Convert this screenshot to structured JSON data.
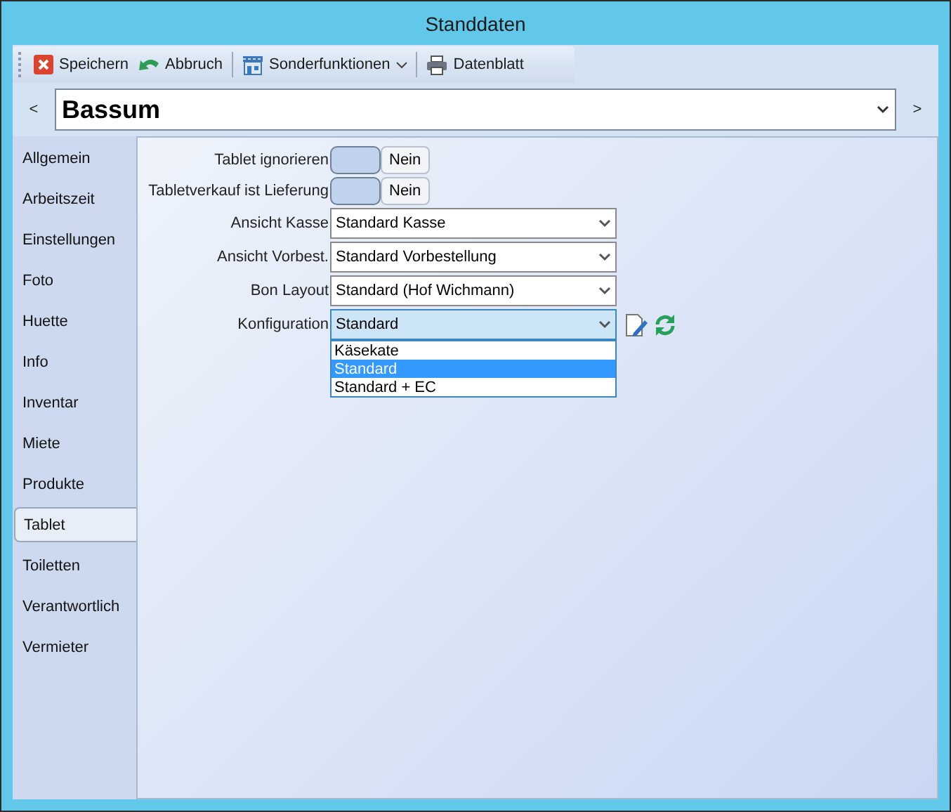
{
  "window": {
    "title": "Standdaten"
  },
  "toolbar": [
    {
      "kind": "save",
      "label": "Speichern"
    },
    {
      "kind": "cancel",
      "label": "Abbruch"
    },
    {
      "kind": "special",
      "label": "Sonderfunktionen",
      "dropdown": true
    },
    {
      "kind": "print",
      "label": "Datenblatt"
    }
  ],
  "record": {
    "prev": "<",
    "value": "Bassum",
    "next": ">"
  },
  "tabs": [
    {
      "label": "Allgemein",
      "selected": false
    },
    {
      "label": "Arbeitszeit",
      "selected": false
    },
    {
      "label": "Einstellungen",
      "selected": false
    },
    {
      "label": "Foto",
      "selected": false
    },
    {
      "label": "Huette",
      "selected": false
    },
    {
      "label": "Info",
      "selected": false
    },
    {
      "label": "Inventar",
      "selected": false
    },
    {
      "label": "Miete",
      "selected": false
    },
    {
      "label": "Produkte",
      "selected": false
    },
    {
      "label": "Tablet",
      "selected": true
    },
    {
      "label": "Toiletten",
      "selected": false
    },
    {
      "label": "Verantwortlich",
      "selected": false
    },
    {
      "label": "Vermieter",
      "selected": false
    }
  ],
  "fields": [
    {
      "kind": "toggle",
      "label": "Tablet ignorieren",
      "on": false,
      "value": "Nein"
    },
    {
      "kind": "toggle",
      "label": "Tabletverkauf ist Lieferung",
      "on": false,
      "value": "Nein"
    },
    {
      "kind": "select",
      "label": "Ansicht Kasse",
      "value": "Standard Kasse"
    },
    {
      "kind": "select",
      "label": "Ansicht Vorbest.",
      "value": "Standard Vorbestellung"
    },
    {
      "kind": "select",
      "label": "Bon Layout",
      "value": "Standard (Hof Wichmann)"
    },
    {
      "kind": "select",
      "label": "Konfiguration",
      "value": "Standard",
      "expanded": true,
      "actions": true,
      "options": [
        {
          "label": "Käsekate",
          "selected": false
        },
        {
          "label": "Standard",
          "selected": true
        },
        {
          "label": "Standard + EC",
          "selected": false
        }
      ]
    }
  ]
}
